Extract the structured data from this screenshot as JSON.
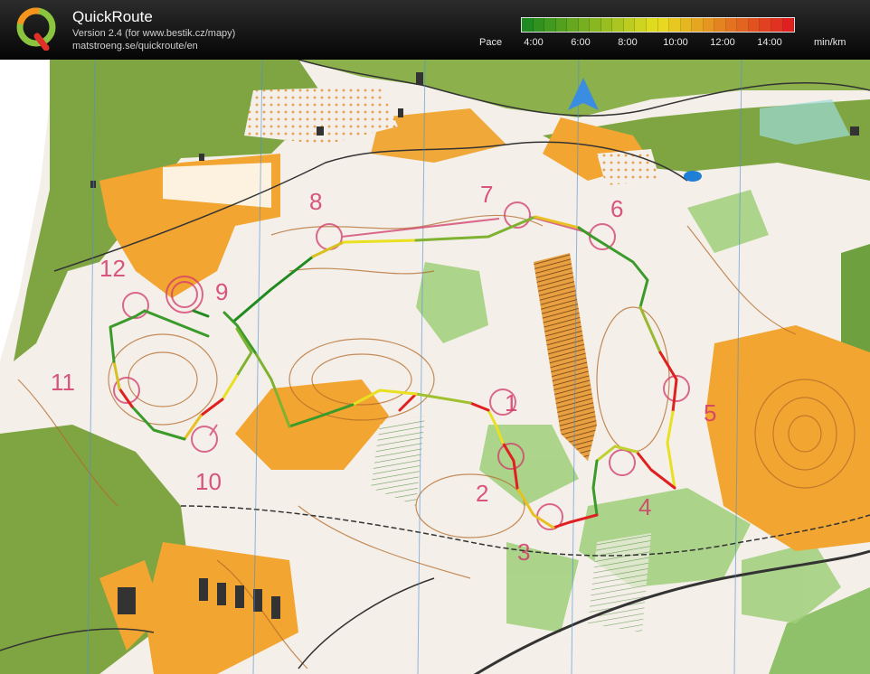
{
  "app": {
    "title": "QuickRoute",
    "version_line": "Version 2.4  (for www.bestik.cz/mapy)",
    "website_line": "matstroeng.se/quickroute/en"
  },
  "legend": {
    "pace_label": "Pace",
    "unit_label": "min/km",
    "ticks": [
      "4:00",
      "6:00",
      "8:00",
      "10:00",
      "12:00",
      "14:00"
    ],
    "colors": {
      "fast": "#1f8a1f",
      "medium": "#e8e020",
      "slow": "#e02020"
    }
  },
  "map": {
    "control_numbers": [
      "1",
      "2",
      "3",
      "4",
      "5",
      "6",
      "7",
      "8",
      "9",
      "10",
      "11",
      "12"
    ],
    "north_arrow": "north-arrow-icon",
    "colors": {
      "open_land": "#f2a531",
      "forest_green": "#7fa542",
      "white_forest": "#f4efe8",
      "contour": "#b36a2a",
      "course_magenta": "#d23a6a",
      "water_blue": "#1f7fd6"
    }
  }
}
